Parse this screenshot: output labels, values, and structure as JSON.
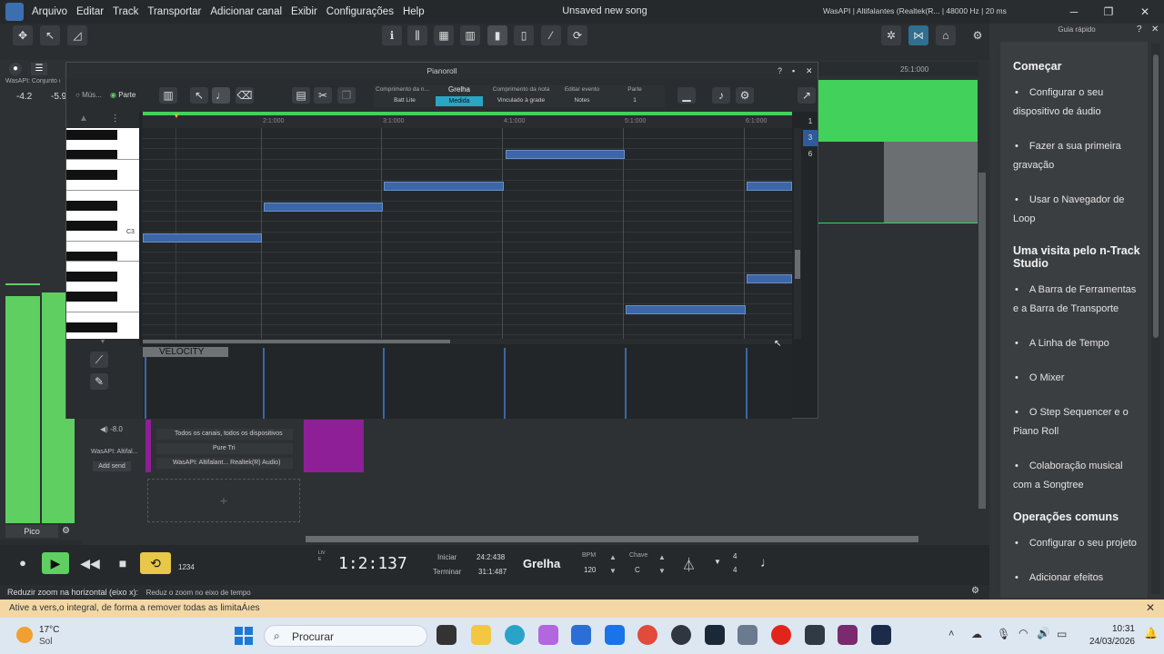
{
  "menu": [
    "Arquivo",
    "Editar",
    "Track",
    "Transportar",
    "Adicionar canal",
    "Exibir",
    "Configurações",
    "Help"
  ],
  "app_title": "Unsaved new song",
  "device_info": "WasAPI | Altifalantes (Realtek(R... | 48000 Hz | 20 ms",
  "quick_guide": {
    "header": "Guia rápido",
    "sections": [
      {
        "title": "Começar",
        "items": [
          "Configurar o seu dispositivo de áudio",
          "Fazer a sua primeira gravação",
          "Usar o Navegador de Loop"
        ]
      },
      {
        "title": "Uma visita pelo n-Track Studio",
        "items": [
          "A Barra de Ferramentas e a Barra de Transporte",
          "A Linha de Tempo",
          "O Mixer",
          "O Step Sequencer e o Piano Roll",
          "Colaboração musical com a Songtree"
        ]
      },
      {
        "title": "Operações comuns",
        "items": [
          "Configurar o seu projeto",
          "Adicionar efeitos"
        ]
      }
    ]
  },
  "mixer": {
    "level_left": "-4.2",
    "level_right": "-5.9",
    "label": "WasAPI: Conjunto de",
    "pico": "Pico"
  },
  "piano_roll": {
    "title": "Pianoroll",
    "mode_mus": "Mús...",
    "mode_parte": "Parte",
    "opt_headers": [
      "Comprimento da n...",
      "Grelha",
      "Comprimento da nota",
      "Editar evento",
      "Parte"
    ],
    "opt_values": [
      "Batt Lite",
      "Medida",
      "Vinculado à grade",
      "Notes",
      "1"
    ],
    "ruler": [
      "1",
      "2:1:000",
      "3:1:000",
      "4:1:000",
      "5:1:000",
      "6:1:000"
    ],
    "ruler_right": "25:1:000",
    "key_label": "C3",
    "velocity": "VELOCITY",
    "side_numbers": [
      "1",
      "3",
      "6"
    ]
  },
  "channel": {
    "input": "Todos os canais, todos os dispositivos",
    "instrument": "Pure Tri",
    "output": "WasAPI: Altifalant... Realtek(R) Audio)",
    "vol": "-8.0",
    "send_label": "WasAPI: Altifal...",
    "add_send": "Add send"
  },
  "transport": {
    "time": "1:2:137",
    "iniciar_label": "Iniciar",
    "iniciar_val": "24:2:438",
    "terminar_label": "Terminar",
    "terminar_val": "31:1:487",
    "grid": "Grelha",
    "bpm_label": "BPM",
    "bpm": "120",
    "key_label": "Chave",
    "key": "C",
    "sig_top": "4",
    "sig_bottom": "4",
    "count": "1234",
    "live": "LIVE"
  },
  "status_text": "Reduzir zoom na horizontal (eixo x):",
  "status_hint": "Reduz o zoom no eixo de tempo",
  "banner": "Ative a vers,o integral, de forma a remover todas as limitaÁıes",
  "taskbar": {
    "temp": "17°C",
    "weather": "Sol",
    "search": "Procurar",
    "time": "10:31",
    "date": "24/03/2026"
  }
}
